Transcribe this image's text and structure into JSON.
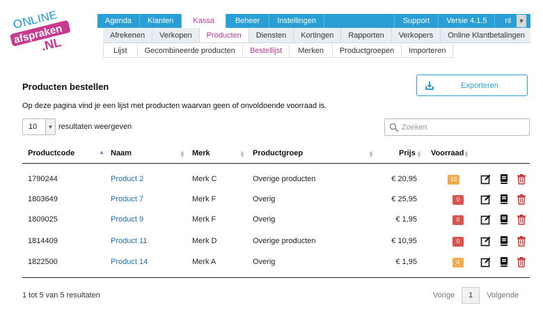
{
  "logo": {
    "line1": "ON",
    "line2": "LINE",
    "line3": "afspraken",
    "line4": ".NL"
  },
  "topnav": {
    "items": [
      "Agenda",
      "Klanten",
      "Kassa",
      "Beheer",
      "Instellingen"
    ],
    "active": "Kassa",
    "support": "Support",
    "version": "Versie 4.1.5",
    "lang": "nl"
  },
  "subnav": {
    "items": [
      "Afrekenen",
      "Verkopen",
      "Producten",
      "Diensten",
      "Kortingen",
      "Rapporten",
      "Verkopers",
      "Online Klantbetalingen"
    ],
    "active": "Producten"
  },
  "thirdnav": {
    "items": [
      "Lijst",
      "Gecombineerde producten",
      "Bestellijst",
      "Merken",
      "Productgroepen",
      "Importeren"
    ],
    "active": "Bestellijst"
  },
  "page": {
    "title": "Producten bestellen",
    "description": "Op deze pagina vind je een lijst met producten waarvan geen of onvoldoende voorraad is.",
    "export_label": "Exporteren"
  },
  "controls": {
    "length_value": "10",
    "length_suffix": "resultaten weergeven",
    "search_placeholder": "Zoeken"
  },
  "table": {
    "headers": {
      "code": "Productcode",
      "name": "Naam",
      "brand": "Merk",
      "group": "Productgroep",
      "price": "Prijs",
      "stock": "Voorraad"
    },
    "rows": [
      {
        "code": "1790244",
        "name": "Product 2",
        "brand": "Merk C",
        "group": "Overige producten",
        "price": "€ 20,95",
        "stock": "10",
        "stock_color": "#f0ad4e"
      },
      {
        "code": "1803649",
        "name": "Product 7",
        "brand": "Merk F",
        "group": "Overig",
        "price": "€ 25,95",
        "stock": "0",
        "stock_color": "#d9534f"
      },
      {
        "code": "1809025",
        "name": "Product 9",
        "brand": "Merk F",
        "group": "Overig",
        "price": "€ 1,95",
        "stock": "0",
        "stock_color": "#d9534f"
      },
      {
        "code": "1814409",
        "name": "Product 11",
        "brand": "Merk D",
        "group": "Overige producten",
        "price": "€ 10,95",
        "stock": "0",
        "stock_color": "#d9534f"
      },
      {
        "code": "1822500",
        "name": "Product 14",
        "brand": "Merk A",
        "group": "Overig",
        "price": "€ 1,95",
        "stock": "4",
        "stock_color": "#f0ad4e"
      }
    ],
    "actions": [
      "edit-icon",
      "book-icon",
      "trash-icon"
    ]
  },
  "footer": {
    "info": "1 tot 5 van 5 resultaten",
    "prev": "Vorige",
    "page": "1",
    "next": "Volgende"
  },
  "colors": {
    "brand_blue": "#2a9fd6",
    "active_pink": "#c0398f",
    "link_blue": "#1a6fb0",
    "logo_blue": "#29a3da",
    "logo_pink": "#c83a8f",
    "delete_red": "#c9302c"
  }
}
